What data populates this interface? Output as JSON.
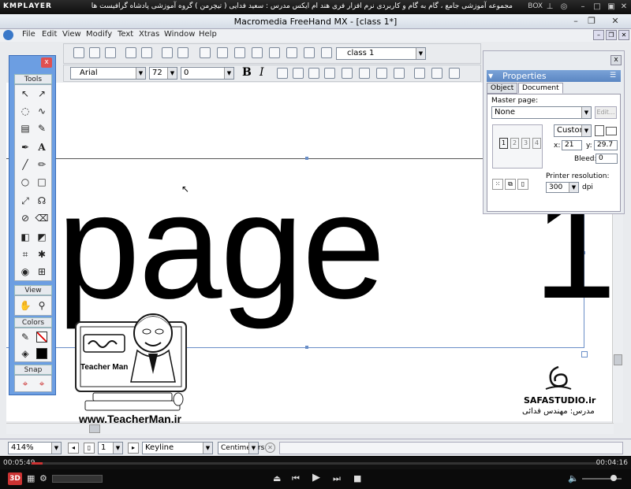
{
  "km": {
    "logo": "KMPLAYER",
    "title": "مجموعه آموزشی جامع ، گام به گام و کاربردی نرم افزار فری هند ام ایکس   مدرس : سعید فدایی ( تیچرمن ) گروه آموزشی پادشاه گرافیست ها",
    "box_label": "BOX",
    "time_elapsed": "00:05:49",
    "time_total": "00:04:16",
    "progress": 0.02,
    "badge": "3D"
  },
  "app": {
    "title": "Macromedia FreeHand MX - [class 1*]",
    "menu": [
      "File",
      "Edit",
      "View",
      "Modify",
      "Text",
      "Xtras",
      "Window",
      "Help"
    ],
    "page_select": "class 1",
    "font_name": "Arial",
    "font_size": "72",
    "leading": "0"
  },
  "canvas": {
    "big_text": "page",
    "big_text_2": "1"
  },
  "tools": {
    "sections": [
      "Tools",
      "View",
      "Colors",
      "Snap"
    ],
    "close": "x"
  },
  "props": {
    "header": "Properties",
    "tabs": [
      "Object",
      "Document"
    ],
    "master_label": "Master page:",
    "master_value": "None",
    "edit_btn": "Edit...",
    "size_value": "Custom",
    "x_label": "x:",
    "x_value": "21",
    "y_label": "y:",
    "y_value": "29.7",
    "bleed_label": "Bleed:",
    "bleed_value": "0",
    "printer_label": "Printer resolution:",
    "printer_value": "300",
    "dpi": "dpi",
    "pages": [
      "1",
      "2",
      "3",
      "4"
    ]
  },
  "status": {
    "zoom": "414%",
    "page_num": "1",
    "view_mode": "Keyline",
    "units": "Centimeters"
  },
  "watermark": {
    "teacher_name": "Teacher Man",
    "teacher_url": "www.TeacherMan.ir",
    "safa": "SAFASTUDIO.ir",
    "safa_sub": "مدرس: مهندس فدائی"
  }
}
